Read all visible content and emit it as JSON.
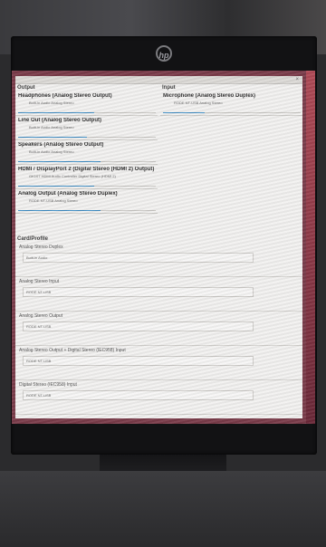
{
  "monitor": {
    "brand_icon": "hp-logo-icon",
    "logo_text": "hp"
  },
  "window": {
    "close_glyph": "×"
  },
  "output": {
    "title": "Output",
    "devices": [
      {
        "name": "Headphones (Analog Stereo Output)",
        "sub": "Built-in Audio Analog Stereo",
        "volume": 0.55
      },
      {
        "name": "Line Out (Analog Stereo Output)",
        "sub": "Built-in Audio Analog Stereo",
        "volume": 0.5
      },
      {
        "name": "Speakers (Analog Stereo Output)",
        "sub": "Built-in Audio Analog Stereo",
        "volume": 0.6
      },
      {
        "name": "HDMI / DisplayPort 2 (Digital Stereo (HDMI 2) Output)",
        "sub": "GK107 HDMI Audio Controller Digital Stereo (HDMI 2)",
        "volume": 0.55
      },
      {
        "name": "Analog Output (Analog Stereo Duplex)",
        "sub": "RODE NT-USB Analog Stereo",
        "volume": 0.6
      }
    ]
  },
  "input": {
    "title": "Input",
    "devices": [
      {
        "name": "Microphone (Analog Stereo Duplex)",
        "sub": "RODE NT-USB Analog Stereo",
        "volume": 0.3
      }
    ]
  },
  "card_profile": {
    "title": "Card/Profile",
    "items": [
      {
        "label": "Analog Stereo Duplex",
        "card": "Built-in Audio"
      },
      {
        "label": "Analog Stereo Input",
        "card": "RODE NT-USB"
      },
      {
        "label": "Analog Stereo Output",
        "card": "RODE NT-USB"
      },
      {
        "label": "Analog Stereo Output + Digital Stereo (IEC958) Input",
        "card": "RODE NT-USB"
      },
      {
        "label": "Digital Stereo (IEC958) Input",
        "card": "RODE NT-USB"
      }
    ]
  },
  "colors": {
    "accent": "#3d8cc4",
    "desktop": "#7a3c4a"
  }
}
